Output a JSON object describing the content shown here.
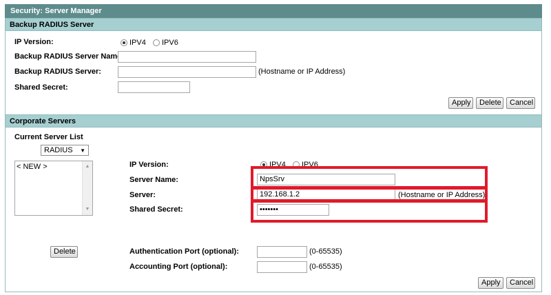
{
  "window": {
    "title": "Security: Server Manager"
  },
  "backup": {
    "section_title": "Backup RADIUS Server",
    "ip_version_label": "IP Version:",
    "ipv4_label": "IPV4",
    "ipv6_label": "IPV6",
    "ip_version_selected": "IPV4",
    "server_name_label": "Backup RADIUS Server Name:",
    "server_name_value": "",
    "server_label": "Backup RADIUS Server:",
    "server_value": "",
    "server_hint": "(Hostname or IP Address)",
    "secret_label": "Shared Secret:",
    "secret_value": "",
    "apply_label": "Apply",
    "delete_label": "Delete",
    "cancel_label": "Cancel"
  },
  "corporate": {
    "section_title": "Corporate Servers",
    "list_title": "Current Server List",
    "type_select": "RADIUS",
    "list_items": [
      "< NEW >"
    ],
    "ip_version_label": "IP Version:",
    "ipv4_label": "IPV4",
    "ipv6_label": "IPV6",
    "ip_version_selected": "IPV4",
    "server_name_label": "Server Name:",
    "server_name_value": "NpsSrv",
    "server_label": "Server:",
    "server_value": "192.168.1.2",
    "server_hint": "(Hostname or IP Address)",
    "secret_label": "Shared Secret:",
    "secret_value": "•••••••",
    "delete_label": "Delete",
    "auth_port_label": "Authentication Port (optional):",
    "auth_port_value": "",
    "auth_port_hint": "(0-65535)",
    "acct_port_label": "Accounting Port (optional):",
    "acct_port_value": "",
    "acct_port_hint": "(0-65535)",
    "apply_label": "Apply",
    "cancel_label": "Cancel"
  },
  "colors": {
    "title_bar": "#5e8b8c",
    "section_bar": "#a6cfd1",
    "highlight": "#e01a2b"
  }
}
